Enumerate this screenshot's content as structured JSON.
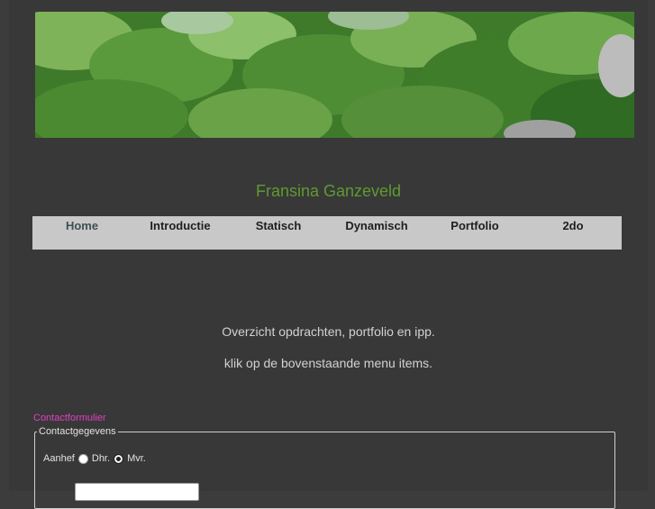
{
  "site": {
    "title": "Fransina Ganzeveld"
  },
  "nav": {
    "items": [
      {
        "label": "Home",
        "active": true
      },
      {
        "label": "Introductie",
        "active": false
      },
      {
        "label": "Statisch",
        "active": false
      },
      {
        "label": "Dynamisch",
        "active": false
      },
      {
        "label": "Portfolio",
        "active": false
      },
      {
        "label": "2do",
        "active": false
      }
    ]
  },
  "main": {
    "line1": "Overzicht opdrachten, portfolio en ipp.",
    "line2": "klik op de bovenstaande menu items."
  },
  "contact": {
    "link_label": "Contactformulier",
    "legend": "Contactgegevens",
    "aanhef_label": "Aanhef",
    "options": [
      {
        "label": "Dhr.",
        "selected": false
      },
      {
        "label": "Mvr.",
        "selected": false
      }
    ],
    "name_value": ""
  },
  "colors": {
    "title": "#5f9a2f",
    "nav_bg": "#c8c8c8",
    "link": "#e040c0",
    "page_bg": "#383838"
  }
}
